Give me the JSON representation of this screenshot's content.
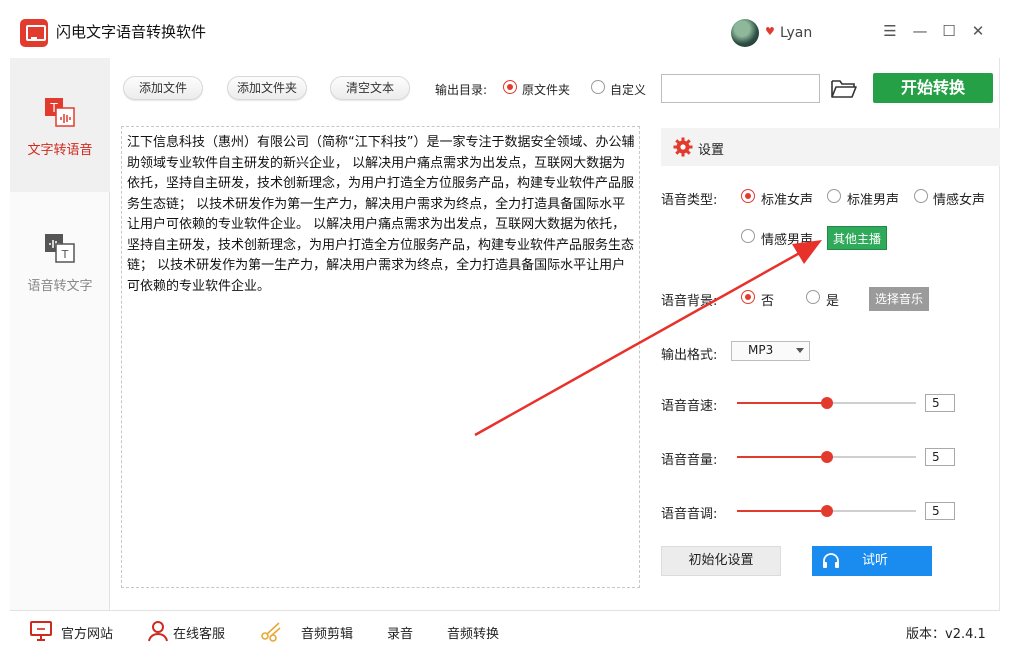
{
  "app": {
    "title": "闪电文字语音转换软件",
    "username": "Lyan"
  },
  "window_controls": {
    "menu": "☰",
    "minimize": "—",
    "maximize": "☐",
    "close": "✕"
  },
  "nav": [
    {
      "label": "文字转语音",
      "active": true
    },
    {
      "label": "语音转文字",
      "active": false
    }
  ],
  "toolbar": {
    "add_file": "添加文件",
    "add_folder": "添加文件夹",
    "clear_text": "清空文本",
    "output_dir_label": "输出目录:",
    "opt_source_folder": "原文件夹",
    "opt_custom": "自定义",
    "output_dir_value": "",
    "start": "开始转换"
  },
  "text_content": "江下信息科技（惠州）有限公司（简称“江下科技”）是一家专注于数据安全领域、办公辅助领域专业软件自主研发的新兴企业， 以解决用户痛点需求为出发点，互联网大数据为依托，坚持自主研发，技术创新理念，为用户打造全方位服务产品，构建专业软件产品服务生态链； 以技术研发作为第一生产力，解决用户需求为终点，全力打造具备国际水平让用户可依赖的专业软件企业。 以解决用户痛点需求为出发点，互联网大数据为依托，坚持自主研发，技术创新理念，为用户打造全方位服务产品，构建专业软件产品服务生态链； 以技术研发作为第一生产力，解决用户需求为终点，全力打造具备国际水平让用户可依赖的专业软件企业。",
  "settings": {
    "title": "设置",
    "voice_type_label": "语音类型:",
    "voice_options": [
      "标准女声",
      "标准男声",
      "情感女声",
      "情感男声"
    ],
    "voice_selected": "标准女声",
    "other_anchor": "其他主播",
    "bg_label": "语音背景:",
    "bg_no": "否",
    "bg_yes": "是",
    "bg_selected": "否",
    "choose_music": "选择音乐",
    "format_label": "输出格式:",
    "format_value": "MP3",
    "speed_label": "语音音速:",
    "speed_value": "5",
    "volume_label": "语音音量:",
    "volume_value": "5",
    "pitch_label": "语音音调:",
    "pitch_value": "5",
    "init_button": "初始化设置",
    "listen_button": "试听"
  },
  "footer": {
    "website": "官方网站",
    "support": "在线客服",
    "audio_cut": "音频剪辑",
    "record": "录音",
    "audio_convert": "音频转换",
    "version": "版本：v2.4.1"
  },
  "colors": {
    "accent": "#e23b2e",
    "start_green": "#26a047",
    "chip_green": "#2fa95a",
    "listen_blue": "#1a8cf0"
  }
}
